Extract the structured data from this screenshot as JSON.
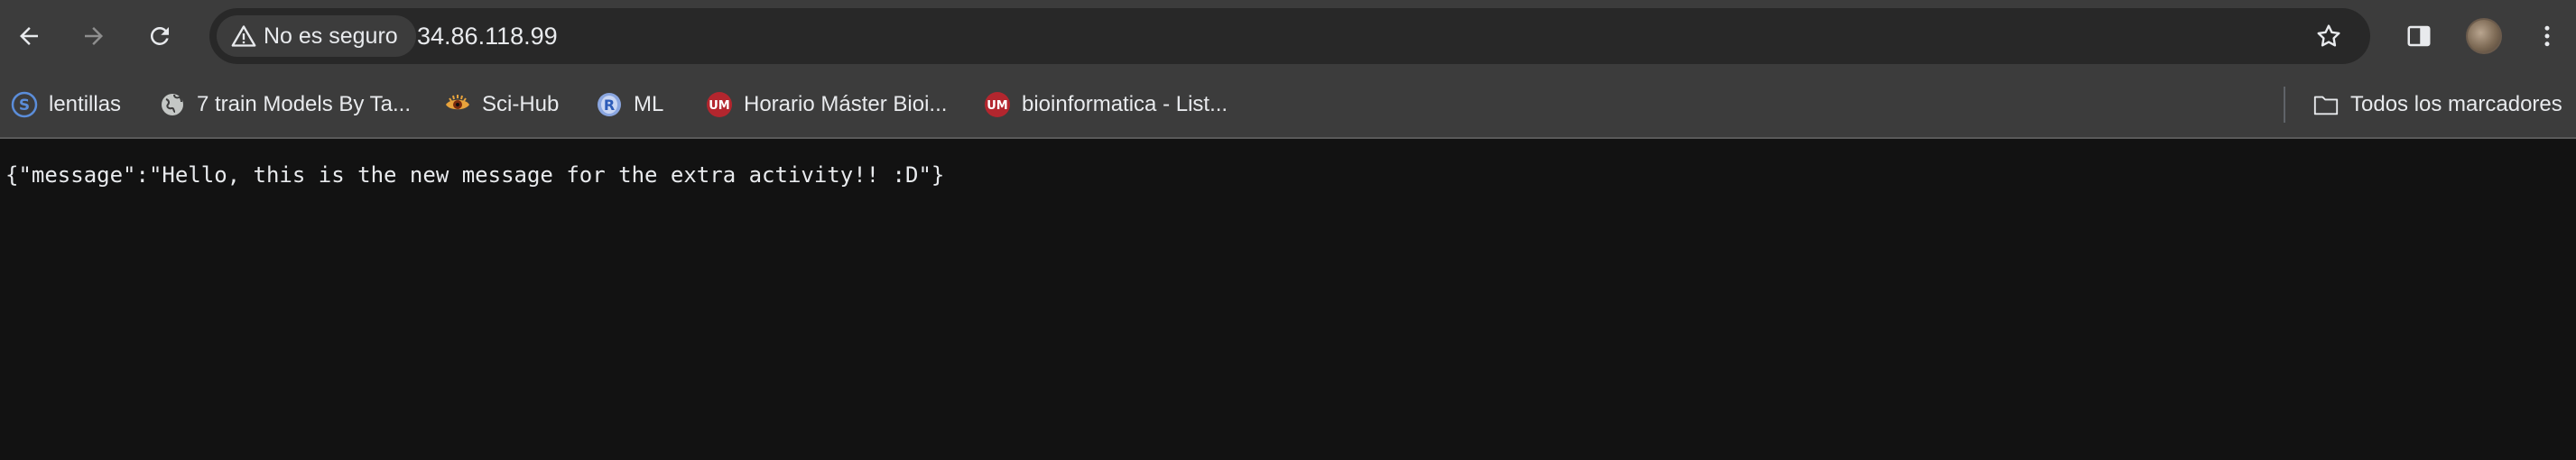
{
  "browser": {
    "security_label": "No es seguro",
    "url": "34.86.118.99",
    "icons": {
      "back": "arrow-left-icon",
      "forward": "arrow-right-icon",
      "reload": "reload-icon",
      "security": "warning-triangle-icon",
      "bookmark_star": "star-icon",
      "side_panel": "side-panel-icon",
      "profile": "avatar",
      "menu": "kebab-menu-icon"
    }
  },
  "bookmarks": {
    "items": [
      {
        "label": "lentillas",
        "icon": "s-circle-icon",
        "color": "#5b8dd9"
      },
      {
        "label": "7 train Models By Ta...",
        "icon": "globe-icon",
        "color": "#c4c7c5"
      },
      {
        "label": "Sci-Hub",
        "icon": "eye-icon",
        "color": "#e8a33c"
      },
      {
        "label": "ML",
        "icon": "r-logo-icon",
        "color": "#6e8fd6"
      },
      {
        "label": "Horario Máster Bioi...",
        "icon": "um-logo-icon",
        "color": "#b3262e"
      },
      {
        "label": "bioinformatica - List...",
        "icon": "um-logo-icon",
        "color": "#b3262e"
      }
    ],
    "all_bookmarks_label": "Todos los marcadores"
  },
  "page": {
    "body_text": "{\"message\":\"Hello, this is the new message for the extra activity!! :D\"}"
  },
  "colors": {
    "toolbar_bg": "#3c3c3c",
    "omnibox_bg": "#282828",
    "page_bg": "#121212",
    "text": "#e8eaed"
  }
}
